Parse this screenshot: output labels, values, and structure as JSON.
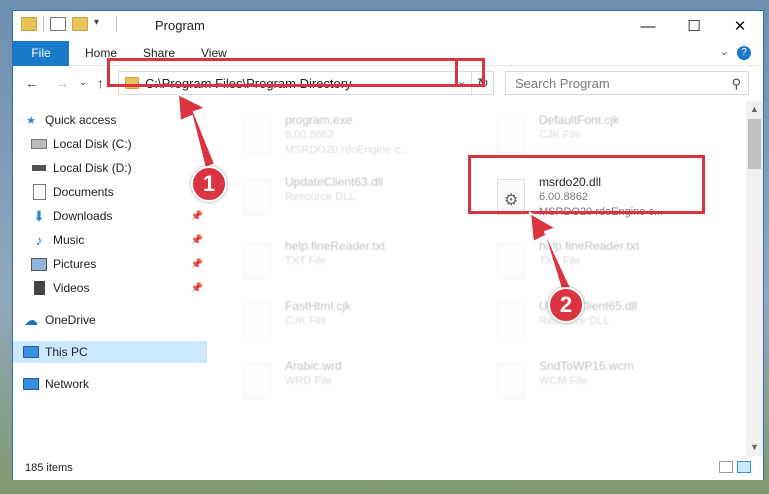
{
  "window": {
    "title": "Program"
  },
  "ribbon": {
    "tabs": [
      "File",
      "Home",
      "Share",
      "View"
    ],
    "help": "?"
  },
  "nav": {
    "address": "C:\\Program Files\\Program Directory",
    "search_placeholder": "Search Program"
  },
  "sidebar": {
    "items": [
      {
        "label": "Quick access",
        "icon": "star-icon",
        "pinned": false
      },
      {
        "label": "Local Disk (C:)",
        "icon": "drive-icon",
        "pinned": false
      },
      {
        "label": "Local Disk (D:)",
        "icon": "drive-icon",
        "pinned": false
      },
      {
        "label": "Documents",
        "icon": "documents-icon",
        "pinned": false
      },
      {
        "label": "Downloads",
        "icon": "download-icon",
        "pinned": true
      },
      {
        "label": "Music",
        "icon": "music-icon",
        "pinned": true
      },
      {
        "label": "Pictures",
        "icon": "pictures-icon",
        "pinned": true
      },
      {
        "label": "Videos",
        "icon": "videos-icon",
        "pinned": true
      },
      {
        "label": "OneDrive",
        "icon": "cloud-icon",
        "pinned": false
      },
      {
        "label": "This PC",
        "icon": "computer-icon",
        "pinned": false,
        "selected": true
      },
      {
        "label": "Network",
        "icon": "network-icon",
        "pinned": false
      }
    ]
  },
  "files": [
    {
      "name": "program.exe",
      "line2": "6.00.8862",
      "line3": "MSRDO20 rdoEngine c..."
    },
    {
      "name": "DefaultFont.cjk",
      "line2": "CJK File",
      "line3": ""
    },
    {
      "name": "UpdateClient63.dll",
      "line2": "Resource DLL",
      "line3": ""
    },
    {
      "name": "msrdo20.dll",
      "line2": "6.00.8862",
      "line3": "MSRDO20 rdoEngine c..."
    },
    {
      "name": "help.fineReader.txt",
      "line2": "TXT File",
      "line3": ""
    },
    {
      "name": "help.fineReader.txt",
      "line2": "TXT File",
      "line3": ""
    },
    {
      "name": "FastHtml.cjk",
      "line2": "CJK File",
      "line3": ""
    },
    {
      "name": "UpdateClient65.dll",
      "line2": "Resource DLL",
      "line3": ""
    },
    {
      "name": "Arabic.wrd",
      "line2": "WRD File",
      "line3": ""
    },
    {
      "name": "SndToWP15.wcm",
      "line2": "WCM File",
      "line3": ""
    }
  ],
  "status": {
    "items": "185 items"
  },
  "callouts": [
    "1",
    "2"
  ],
  "colors": {
    "highlight": "#d9343f",
    "accent": "#1979ca",
    "selected": "#cce8ff"
  }
}
